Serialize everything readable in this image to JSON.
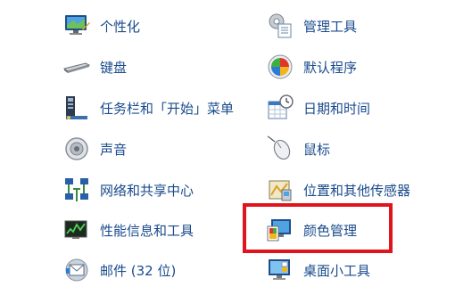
{
  "control_panel": {
    "left_column": [
      {
        "label": "个性化",
        "icon": "personalization-icon"
      },
      {
        "label": "键盘",
        "icon": "keyboard-icon"
      },
      {
        "label": "任务栏和「开始」菜单",
        "icon": "taskbar-start-menu-icon"
      },
      {
        "label": "声音",
        "icon": "sound-icon"
      },
      {
        "label": "网络和共享中心",
        "icon": "network-sharing-icon"
      },
      {
        "label": "性能信息和工具",
        "icon": "performance-icon"
      },
      {
        "label": "邮件 (32 位)",
        "icon": "mail-icon"
      }
    ],
    "right_column": [
      {
        "label": "管理工具",
        "icon": "admin-tools-icon"
      },
      {
        "label": "默认程序",
        "icon": "default-programs-icon"
      },
      {
        "label": "日期和时间",
        "icon": "date-time-icon"
      },
      {
        "label": "鼠标",
        "icon": "mouse-icon"
      },
      {
        "label": "位置和其他传感器",
        "icon": "location-sensors-icon"
      },
      {
        "label": "颜色管理",
        "icon": "color-management-icon"
      },
      {
        "label": "桌面小工具",
        "icon": "desktop-gadgets-icon"
      }
    ]
  },
  "colors": {
    "link_text": "#1a4b8c",
    "highlight_border": "#e0141c"
  }
}
